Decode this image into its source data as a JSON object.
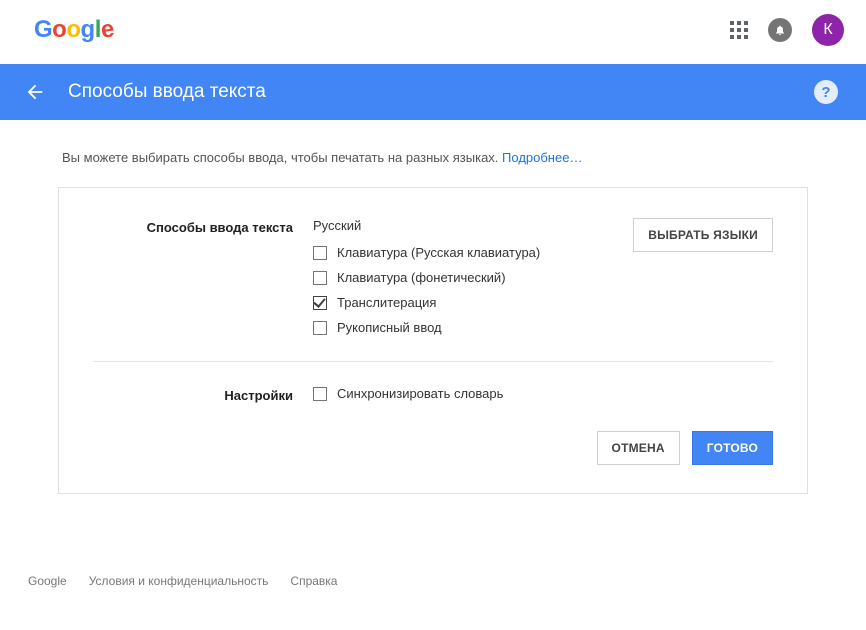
{
  "topbar": {
    "avatar_letter": "К"
  },
  "header": {
    "title": "Способы ввода текста"
  },
  "intro": {
    "text": "Вы можете выбирать способы ввода, чтобы печатать на разных языках. ",
    "link": "Подробнее…"
  },
  "card": {
    "section1": {
      "label": "Способы ввода текста",
      "language": "Русский",
      "select_btn": "ВЫБРАТЬ ЯЗЫКИ",
      "options": [
        {
          "label": "Клавиатура (Русская клавиатура)",
          "checked": false
        },
        {
          "label": "Клавиатура (фонетический)",
          "checked": false
        },
        {
          "label": "Транслитерация",
          "checked": true
        },
        {
          "label": "Рукописный ввод",
          "checked": false
        }
      ]
    },
    "section2": {
      "label": "Настройки",
      "option": {
        "label": "Синхронизировать словарь",
        "checked": false
      }
    },
    "actions": {
      "cancel": "ОТМЕНА",
      "done": "ГОТОВО"
    }
  },
  "footer": {
    "brand": "Google",
    "privacy": "Условия и конфиденциальность",
    "help": "Справка"
  }
}
